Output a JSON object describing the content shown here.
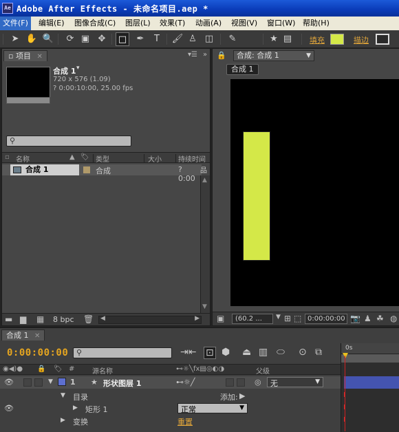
{
  "window": {
    "app_icon_text": "Ae",
    "title": "Adobe After Effects - 未命名项目.aep *"
  },
  "menu": [
    "文件(F)",
    "编辑(E)",
    "图像合成(C)",
    "图层(L)",
    "效果(T)",
    "动画(A)",
    "视图(V)",
    "窗口(W)",
    "帮助(H)"
  ],
  "toolbar": {
    "fill_label": "填充",
    "stroke_label": "描边",
    "fill_color": "#d4e848"
  },
  "project": {
    "tab_label": "项目",
    "comp_name": "合成 1",
    "comp_size": "720 x 576 (1.09)",
    "comp_duration": "? 0:00:10:00, 25.00 fps",
    "columns": {
      "name": "名称",
      "type": "类型",
      "size": "大小",
      "duration": "持续时间"
    },
    "item": {
      "name": "合成 1",
      "type": "合成",
      "duration": "? 0:00"
    },
    "bpc": "8 bpc"
  },
  "composition": {
    "tab_label": "合成: 合成 1",
    "breadcrumb": "合成 1",
    "zoom": "(60.2 ...",
    "timecode": "0:00:00:00",
    "shape_color": "#d4e848"
  },
  "timeline": {
    "tab_label": "合成 1",
    "current_time": "0:00:00:00",
    "columns": {
      "num": "#",
      "source_name": "源名称",
      "parent": "父级"
    },
    "layer": {
      "number": "1",
      "name": "形状图层 1",
      "parent": "无",
      "label_color": "#5d6fd0"
    },
    "contents_label": "目录",
    "add_label": "添加:",
    "shape_label": "矩形 1",
    "blend_mode": "正常",
    "transform_label": "变换",
    "reset_label": "重置",
    "ruler_start": "0s"
  }
}
